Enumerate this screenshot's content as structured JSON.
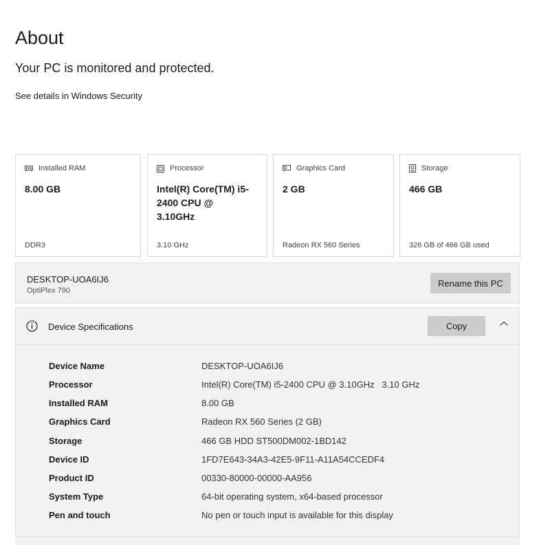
{
  "header": {
    "title": "About",
    "subtitle": "Your PC is monitored and protected.",
    "details_link": "See details in Windows Security"
  },
  "cards": [
    {
      "icon": "memory-icon",
      "label": "Installed RAM",
      "value": "8.00 GB",
      "footer": "DDR3"
    },
    {
      "icon": "processor-icon",
      "label": "Processor",
      "value": "Intel(R) Core(TM) i5-2400 CPU @ 3.10GHz",
      "footer": "3.10 GHz"
    },
    {
      "icon": "graphics-card-icon",
      "label": "Graphics Card",
      "value": "2 GB",
      "footer": "Radeon RX 560 Series"
    },
    {
      "icon": "storage-icon",
      "label": "Storage",
      "value": "466 GB",
      "footer": "326 GB of 466 GB used"
    }
  ],
  "pc": {
    "name": "DESKTOP-UOA6IJ6",
    "model": "OptiPlex 790",
    "rename_label": "Rename this PC"
  },
  "specs": {
    "icon": "info-icon",
    "title": "Device Specifications",
    "copy_label": "Copy",
    "collapse_icon": "chevron-up-icon",
    "rows": [
      {
        "key": "Device Name",
        "value": "DESKTOP-UOA6IJ6"
      },
      {
        "key": "Processor",
        "value": "Intel(R) Core(TM) i5-2400 CPU @ 3.10GHz   3.10 GHz"
      },
      {
        "key": "Installed RAM",
        "value": "8.00 GB"
      },
      {
        "key": "Graphics Card",
        "value": "Radeon RX 560 Series (2 GB)"
      },
      {
        "key": "Storage",
        "value": "466 GB HDD ST500DM002-1BD142"
      },
      {
        "key": "Device ID",
        "value": "1FD7E643-34A3-42E5-9F11-A11A54CCEDF4"
      },
      {
        "key": "Product ID",
        "value": "00330-80000-00000-AA956"
      },
      {
        "key": "System Type",
        "value": "64-bit operating system, x64-based processor"
      },
      {
        "key": "Pen and touch",
        "value": "No pen or touch input is available for this display"
      }
    ]
  },
  "colors": {
    "button_bg": "#cccccc",
    "panel_bg": "#f2f2f2",
    "border": "#d9d9d9"
  }
}
